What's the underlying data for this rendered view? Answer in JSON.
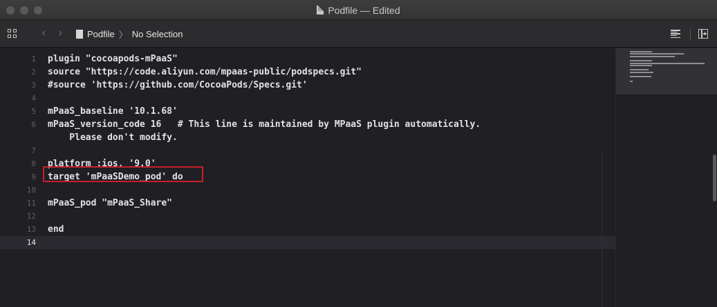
{
  "window": {
    "title": "Podfile — Edited"
  },
  "jumpbar": {
    "back_symbol": "‹",
    "forward_symbol": "›",
    "file": "Podfile",
    "separator": "〉",
    "selection": "No Selection"
  },
  "editor": {
    "lines": [
      {
        "number": "1",
        "text": "plugin \"cocoapods-mPaaS\""
      },
      {
        "number": "2",
        "text": "source \"https://code.aliyun.com/mpaas-public/podspecs.git\""
      },
      {
        "number": "3",
        "text": "#source 'https://github.com/CocoaPods/Specs.git'"
      },
      {
        "number": "4",
        "text": ""
      },
      {
        "number": "5",
        "text": "mPaaS_baseline '10.1.68'"
      },
      {
        "number": "6",
        "text": "mPaaS_version_code 16   # This line is maintained by MPaaS plugin automatically."
      },
      {
        "number": "",
        "text": "    Please don't modify."
      },
      {
        "number": "7",
        "text": ""
      },
      {
        "number": "8",
        "text": "platform :ios, '9.0'"
      },
      {
        "number": "9",
        "text": "target 'mPaaSDemo_pod' do"
      },
      {
        "number": "10",
        "text": ""
      },
      {
        "number": "11",
        "text": "mPaaS_pod \"mPaaS_Share\""
      },
      {
        "number": "12",
        "text": ""
      },
      {
        "number": "13",
        "text": "end"
      },
      {
        "number": "14",
        "text": ""
      }
    ],
    "current_line": "14",
    "highlighted_line": "11"
  },
  "colors": {
    "background": "#1f1f24",
    "highlight_border": "#c8212b",
    "text": "#e3e3e6",
    "line_numbers": "#5f6068"
  },
  "icons": {
    "related_items": "grid-icon",
    "back": "chevron-left-icon",
    "forward": "chevron-right-icon",
    "file": "document-icon",
    "editor_options": "lines-icon",
    "add_editor": "add-editor-icon"
  }
}
